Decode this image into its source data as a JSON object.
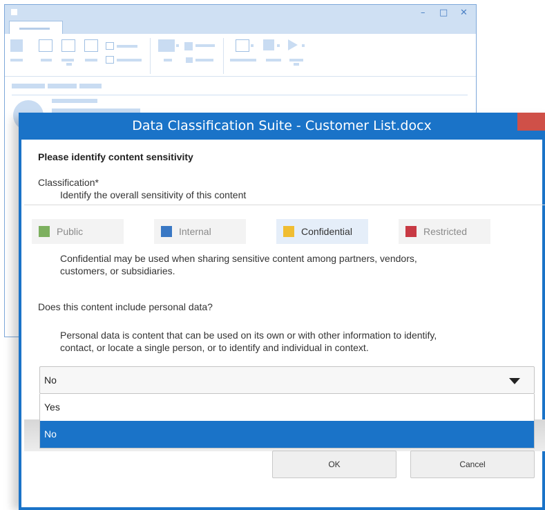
{
  "background_window": {
    "controls": {
      "minimize": "–",
      "maximize": "□",
      "close": "✕"
    }
  },
  "dialog": {
    "title": "Data Classification Suite - Customer List.docx",
    "heading": "Please identify content sensitivity",
    "classification": {
      "label": "Classification*",
      "hint": "Identify the overall sensitivity of this content",
      "options": [
        {
          "label": "Public",
          "color": "#7db05f",
          "selected": false
        },
        {
          "label": "Internal",
          "color": "#3a78c4",
          "selected": false
        },
        {
          "label": "Confidential",
          "color": "#f0bd32",
          "selected": true
        },
        {
          "label": "Restricted",
          "color": "#c83a44",
          "selected": false
        }
      ],
      "description_line1": "Confidential may be used when sharing sensitive content among partners, vendors,",
      "description_line2": "customers, or subsidiaries."
    },
    "personal_data": {
      "question": "Does this content include personal data?",
      "hint_line1": "Personal data is content that can be used on its own or with other information to identify,",
      "hint_line2": "contact, or locate a single person, or to identify and individual in context.",
      "selected_value": "No",
      "options": [
        "Yes",
        "No"
      ],
      "highlighted_option": "No"
    },
    "buttons": {
      "ok": "OK",
      "cancel": "Cancel"
    }
  },
  "colors": {
    "accent": "#1a73c8",
    "close": "#cf5048"
  }
}
